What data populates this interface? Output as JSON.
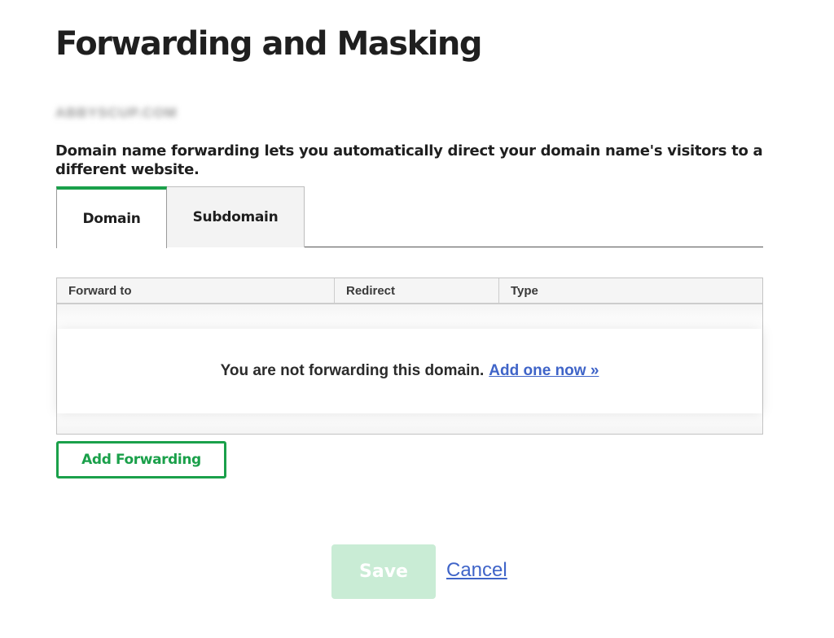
{
  "page": {
    "title": "Forwarding and Masking",
    "domain": "ABBYSCUP.COM",
    "description": "Domain name forwarding lets you automatically direct your domain name's visitors to a different website."
  },
  "tabs": [
    {
      "label": "Domain",
      "active": true
    },
    {
      "label": "Subdomain",
      "active": false
    }
  ],
  "table": {
    "columns": [
      "Forward to",
      "Redirect",
      "Type"
    ],
    "empty_message": "You are not forwarding this domain.",
    "empty_link": "Add one now »"
  },
  "actions": {
    "add_forwarding": "Add Forwarding",
    "save": "Save",
    "cancel": "Cancel"
  },
  "colors": {
    "accent_green": "#1aa04a",
    "link_blue": "#3f64c8",
    "save_disabled": "#c9ecd5"
  }
}
